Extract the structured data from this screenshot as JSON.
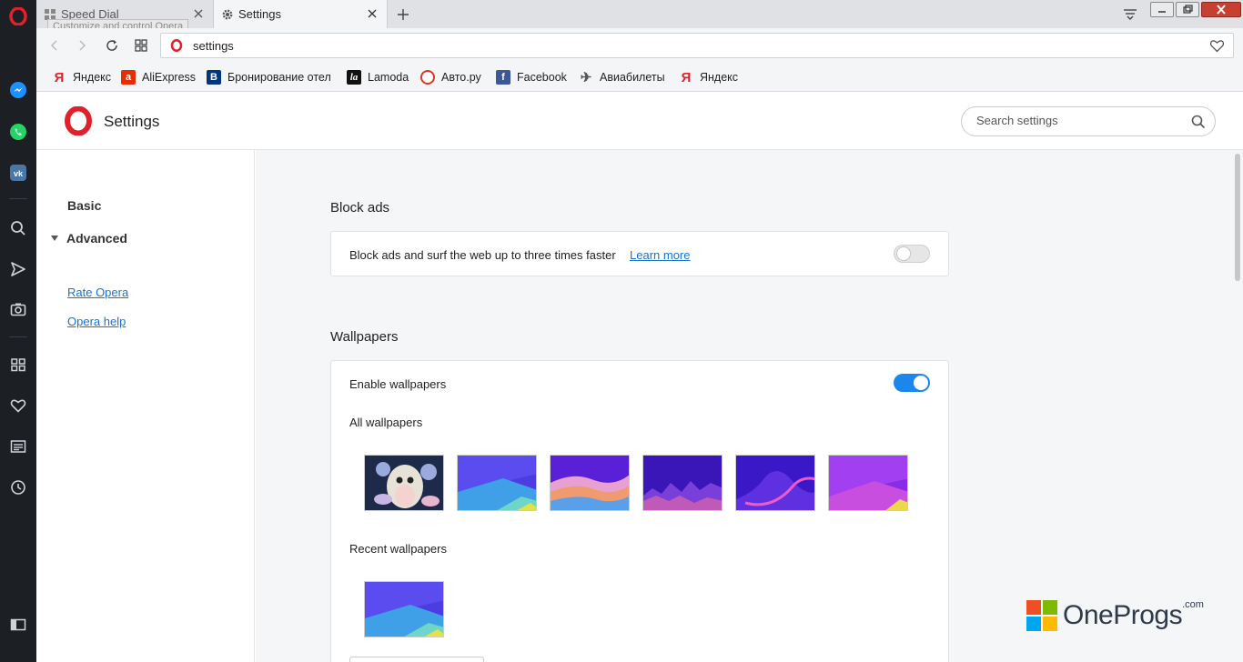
{
  "browser": {
    "tooltip": "Customize and control Opera",
    "tabs": [
      {
        "title": "Speed Dial",
        "active": false
      },
      {
        "title": "Settings",
        "active": true
      }
    ],
    "new_tab_label": "+",
    "address": "settings"
  },
  "bookmarks": [
    {
      "label": "Яндекс",
      "icon": "yandex-icon"
    },
    {
      "label": "AliExpress",
      "icon": "aliexpress-icon"
    },
    {
      "label": "Бронирование отел",
      "icon": "booking-icon"
    },
    {
      "label": "Lamoda",
      "icon": "lamoda-icon"
    },
    {
      "label": "Авто.ру",
      "icon": "autoru-icon"
    },
    {
      "label": "Facebook",
      "icon": "facebook-icon"
    },
    {
      "label": "Авиабилеты",
      "icon": "plane-icon"
    },
    {
      "label": "Яндекс",
      "icon": "yandex-icon"
    }
  ],
  "settings": {
    "title": "Settings",
    "search_placeholder": "Search settings",
    "nav": {
      "basic": "Basic",
      "advanced": "Advanced",
      "rate": "Rate Opera",
      "help": "Opera help"
    },
    "block_ads": {
      "title": "Block ads",
      "text": "Block ads and surf the web up to three times faster",
      "learn_more": "Learn more",
      "enabled": false
    },
    "wallpapers": {
      "title": "Wallpapers",
      "enable_label": "Enable wallpapers",
      "enabled": true,
      "all_label": "All wallpapers",
      "recent_label": "Recent wallpapers"
    }
  },
  "watermark": {
    "brand": "OneProgs",
    "suffix": ".com"
  },
  "colors": {
    "opera_red": "#e0202a",
    "accent_blue": "#1b87ec",
    "link_blue": "#1a73c8",
    "sidebar_bg": "#1c1f23"
  }
}
